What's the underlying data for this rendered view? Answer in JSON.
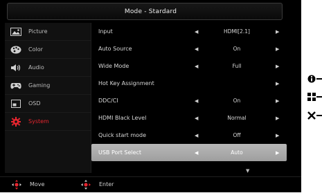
{
  "title": "Mode - Stardard",
  "sidebar": {
    "items": [
      {
        "label": "Picture",
        "icon": "picture-icon",
        "active": false
      },
      {
        "label": "Color",
        "icon": "color-palette-icon",
        "active": false
      },
      {
        "label": "Audio",
        "icon": "speaker-icon",
        "active": false
      },
      {
        "label": "Gaming",
        "icon": "gamepad-icon",
        "active": false
      },
      {
        "label": "OSD",
        "icon": "osd-icon",
        "active": false
      },
      {
        "label": "System",
        "icon": "gear-icon",
        "active": true
      }
    ]
  },
  "settings": {
    "rows": [
      {
        "label": "Input",
        "value": "HDMI[2.1]",
        "left_arrow": "◀",
        "right_arrow": "▶"
      },
      {
        "label": "Auto Source",
        "value": "On",
        "left_arrow": "◀",
        "right_arrow": "▶"
      },
      {
        "label": "Wide Mode",
        "value": "Full",
        "left_arrow": "◀",
        "right_arrow": "▶"
      },
      {
        "label": "Hot Key Assignment",
        "value": "",
        "left_arrow": "",
        "right_arrow": "▶"
      },
      {
        "label": "DDC/CI",
        "value": "On",
        "left_arrow": "◀",
        "right_arrow": "▶"
      },
      {
        "label": "HDMI Black Level",
        "value": "Normal",
        "left_arrow": "◀",
        "right_arrow": "▶"
      },
      {
        "label": "Quick start mode",
        "value": "Off",
        "left_arrow": "◀",
        "right_arrow": "▶"
      },
      {
        "label": "USB Port Select",
        "value": "Auto",
        "left_arrow": "◀",
        "right_arrow": "▶",
        "selected": true
      }
    ],
    "scroll_indicator": "▼"
  },
  "footer": {
    "move_label": "Move",
    "enter_label": "Enter"
  },
  "key_guide": {
    "items": [
      {
        "icon": "info-icon"
      },
      {
        "icon": "grid-icon"
      },
      {
        "icon": "close-icon"
      }
    ]
  },
  "colors": {
    "accent": "#e8252f",
    "background": "#000000",
    "selected_row": "#a8a8a8"
  }
}
